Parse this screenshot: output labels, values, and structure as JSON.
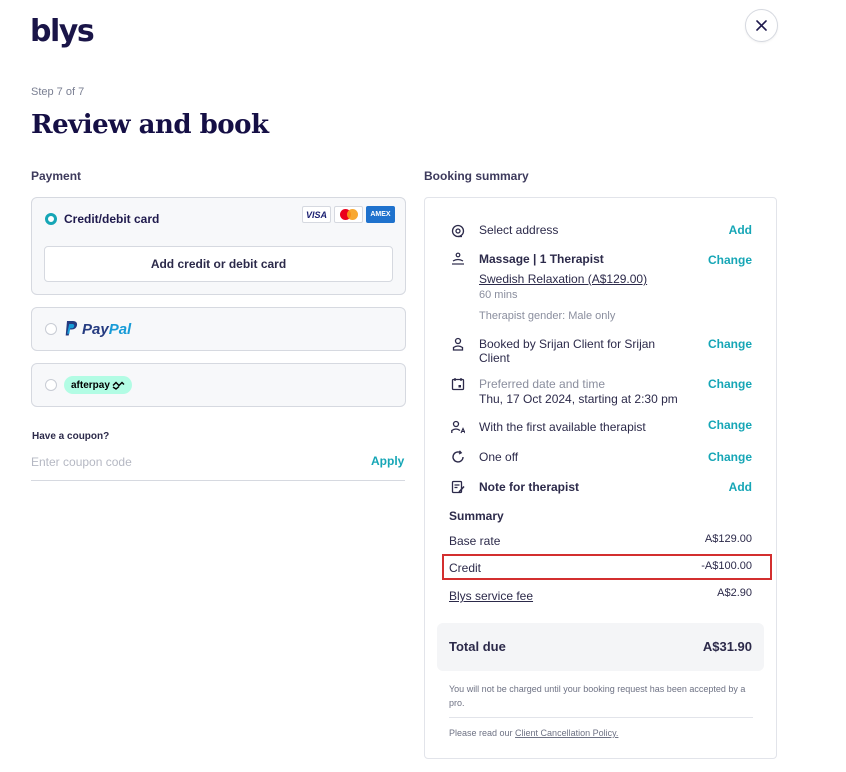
{
  "brand": {
    "logo": "blys"
  },
  "header": {
    "step": "Step 7 of 7",
    "title": "Review and book"
  },
  "payment": {
    "label": "Payment",
    "credit": {
      "label": "Credit/debit card",
      "add_button": "Add credit or debit card",
      "cards": [
        "VISA",
        "AMEX"
      ]
    },
    "paypal": {
      "pay": "Pay",
      "pal": "Pal"
    },
    "afterpay": {
      "label": "afterpay"
    },
    "coupon": {
      "label": "Have a coupon?",
      "placeholder": "Enter coupon code",
      "apply": "Apply"
    }
  },
  "booking": {
    "label": "Booking summary",
    "address": {
      "text": "Select address",
      "action": "Add"
    },
    "massage": {
      "title": "Massage | 1 Therapist",
      "treatment": "Swedish Relaxation (A$129.00)",
      "duration": "60 mins",
      "gender": "Therapist gender: Male only",
      "action": "Change"
    },
    "booked_by": {
      "text": "Booked by Srijan Client for Srijan Client",
      "action": "Change"
    },
    "datetime": {
      "label": "Preferred date and time",
      "value": "Thu, 17 Oct 2024, starting at 2:30 pm",
      "action": "Change"
    },
    "therapist": {
      "text": "With the first available therapist",
      "action": "Change"
    },
    "frequency": {
      "text": "One off",
      "action": "Change"
    },
    "note": {
      "text": "Note for therapist",
      "action": "Add"
    }
  },
  "summary": {
    "title": "Summary",
    "base_rate": {
      "label": "Base rate",
      "value": "A$129.00"
    },
    "credit": {
      "label": "Credit",
      "value": "-A$100.00"
    },
    "service_fee": {
      "label": "Blys service fee",
      "value": "A$2.90"
    },
    "total": {
      "label": "Total due",
      "value": "A$31.90"
    },
    "note": "You will not be charged until your booking request has been accepted by a pro.",
    "policy_prefix": "Please read our ",
    "policy_link": "Client Cancellation Policy."
  }
}
